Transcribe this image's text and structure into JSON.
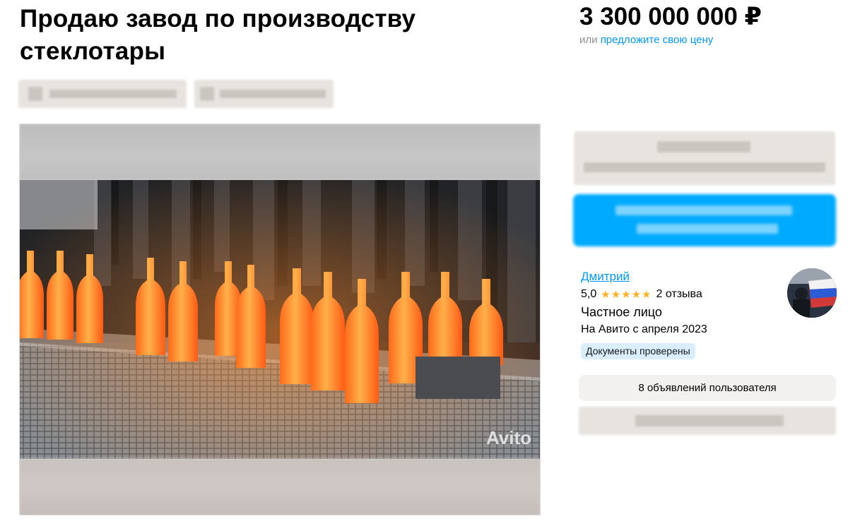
{
  "listing": {
    "title": "Продаю завод по производству стеклотары",
    "price": "3 300 000 000 ₽",
    "price_prefix": "или",
    "offer_link": "предложите свою цену"
  },
  "gallery": {
    "watermark": "Avito"
  },
  "seller": {
    "name": "Дмитрий",
    "rating": "5,0",
    "stars": "★★★★★",
    "reviews": "2 отзыва",
    "type": "Частное лицо",
    "since": "На Авито с апреля 2023",
    "verified_badge": "Документы проверены",
    "listings_button": "8 объявлений пользователя"
  },
  "colors": {
    "accent_link": "#0099f7",
    "contact_button": "#00aaff",
    "star": "#ffb021",
    "badge_bg": "#d9efff"
  }
}
